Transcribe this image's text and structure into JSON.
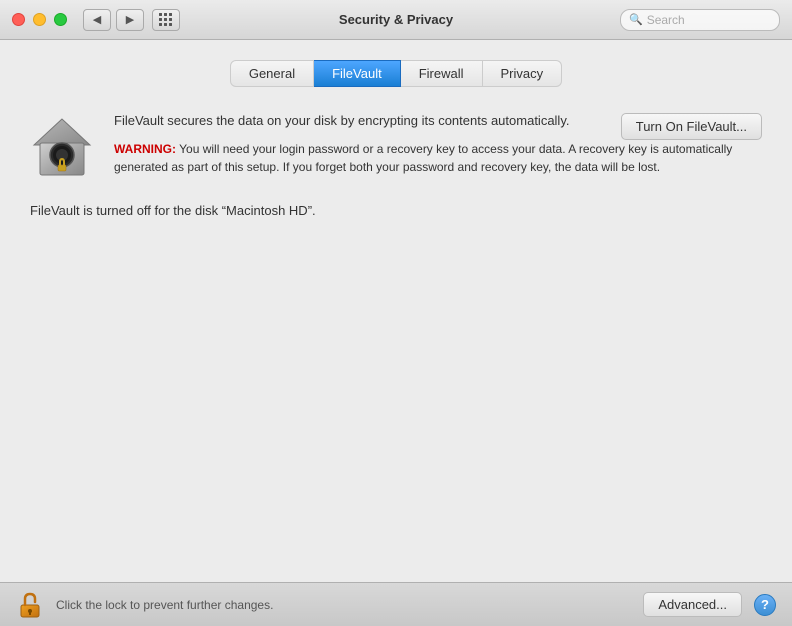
{
  "titlebar": {
    "title": "Security & Privacy",
    "search_placeholder": "Search",
    "back_icon": "◀",
    "forward_icon": "▶"
  },
  "tabs": [
    {
      "id": "general",
      "label": "General",
      "active": false
    },
    {
      "id": "filevault",
      "label": "FileVault",
      "active": true
    },
    {
      "id": "firewall",
      "label": "Firewall",
      "active": false
    },
    {
      "id": "privacy",
      "label": "Privacy",
      "active": false
    }
  ],
  "filevault": {
    "description": "FileVault secures the data on your disk by encrypting its contents automatically.",
    "warning_label": "WARNING:",
    "warning_text": " You will need your login password or a recovery key to access your data. A recovery key is automatically generated as part of this setup. If you forget both your password and recovery key, the data will be lost.",
    "turn_on_button": "Turn On FileVault...",
    "status_text": "FileVault is turned off for the disk “Macintosh HD”."
  },
  "bottom_bar": {
    "lock_text": "Click the lock to prevent further changes.",
    "advanced_button": "Advanced...",
    "help_button": "?"
  }
}
